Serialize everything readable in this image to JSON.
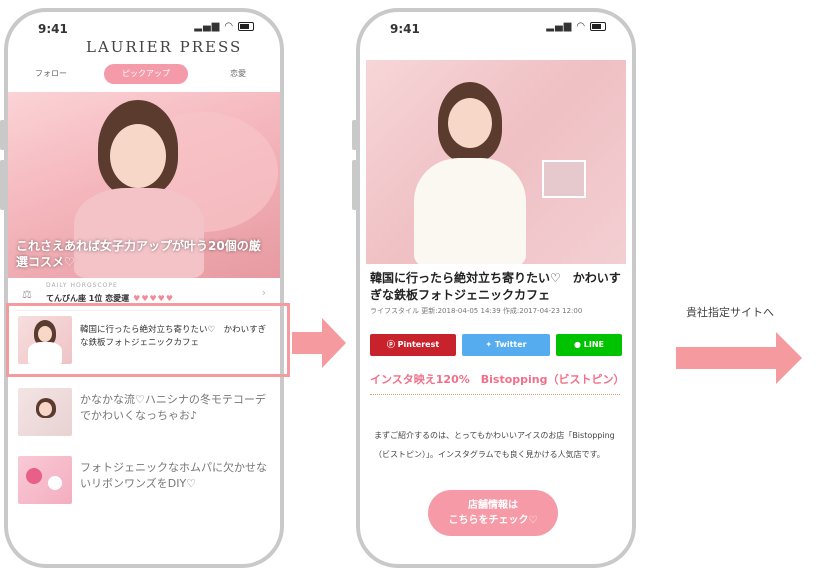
{
  "left_phone": {
    "time": "9:41",
    "brand": "LAURIER PRESS",
    "tabs": [
      "フォロー",
      "ピックアップ",
      "恋愛"
    ],
    "hero_title": "これさえあれば女子力アップが叶う20個の厳選コスメ♡",
    "daily": {
      "sub": "DAILY HOROSCOPE",
      "main": "てんびん座 1位 恋愛運",
      "hearts": "♥♥♥♥♥"
    },
    "items": [
      {
        "text": "韓国に行ったら絶対立ち寄りたい♡　かわいすぎな鉄板フォトジェニックカフェ"
      },
      {
        "text": "かなかな流♡ハニシナの冬モテコーデでかわいくなっちゃお♪"
      },
      {
        "text": "フォトジェニックなホムパに欠かせないリボンワンズをDIY♡"
      }
    ]
  },
  "right_phone": {
    "time": "9:41",
    "article_title": "韓国に行ったら絶対立ち寄りたい♡　かわいすぎな鉄板フォトジェニックカフェ",
    "meta": "ライフスタイル 更新:2018-04-05 14:39 作成:2017-04-23 12:00",
    "share": {
      "pinterest": "Pinterest",
      "twitter": "Twitter",
      "line": "LINE"
    },
    "sub_heading": "インスタ映え120%　Bistopping（ビストピン）",
    "body": "まずご紹介するのは、とってもかわいいアイスのお店「Bistopping（ビストピン）」。インスタグラムでも良く見かける人気店です。",
    "cta_line1": "店舗情報は",
    "cta_line2": "こちらをチェック♡"
  },
  "destination_label": "貴社指定サイトへ",
  "colors": {
    "accent_pink": "#f59a9e",
    "pinterest": "#c8232c",
    "twitter": "#55acee",
    "line": "#00c300",
    "heading_pink": "#f0708a"
  }
}
